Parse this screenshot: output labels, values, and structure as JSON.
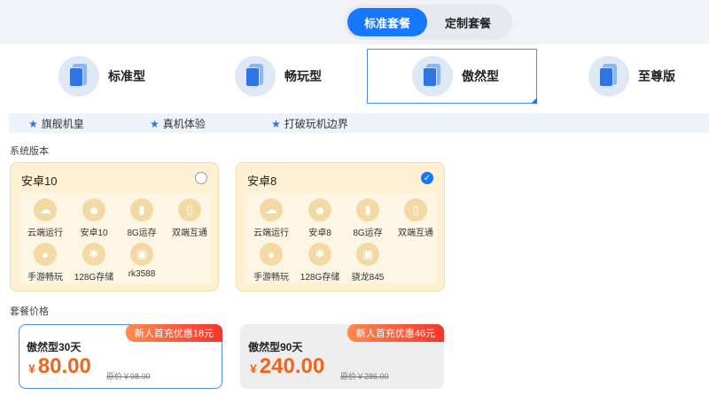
{
  "package_toggle": {
    "standard": "标准套餐",
    "custom": "定制套餐"
  },
  "tiers": [
    {
      "label": "标准型"
    },
    {
      "label": "畅玩型"
    },
    {
      "label": "傲然型"
    },
    {
      "label": "至尊版"
    }
  ],
  "features": [
    "旗舰机皇",
    "真机体验",
    "打破玩机边界"
  ],
  "system_section_title": "系统版本",
  "versions": [
    {
      "title": "安卓10",
      "checked": false,
      "specs": [
        "云端运行",
        "安卓10",
        "8G运存",
        "双端互通",
        "手游畅玩",
        "128G存储",
        "rk3588"
      ]
    },
    {
      "title": "安卓8",
      "checked": true,
      "specs": [
        "云端运行",
        "安卓8",
        "8G运存",
        "双端互通",
        "手游畅玩",
        "128G存储",
        "骁龙845"
      ]
    }
  ],
  "price_section_title": "套餐价格",
  "plans": [
    {
      "name": "傲然型30天",
      "promo": "新人首充优惠18元",
      "currency": "¥",
      "price": "80.00",
      "original": "原价￥98.00"
    },
    {
      "name": "傲然型90天",
      "promo": "新人首充优惠46元",
      "currency": "¥",
      "price": "240.00",
      "original": "原价￥286.00"
    }
  ],
  "colors": {
    "accent": "#1677ff",
    "price": "#f0651e",
    "promo_end": "#f2352a",
    "card_bg": "#fdf0d3"
  },
  "icons": {
    "tier": "phone-icon",
    "feature": "star-icon",
    "checked": "check-icon"
  }
}
